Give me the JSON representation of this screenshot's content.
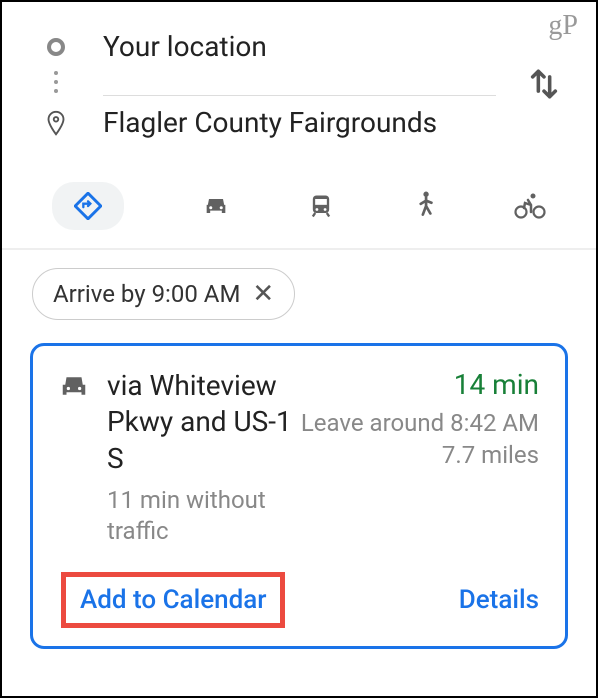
{
  "watermark": "gP",
  "locations": {
    "origin": "Your location",
    "destination": "Flagler County Fairgrounds"
  },
  "filter": {
    "label": "Arrive by 9:00 AM"
  },
  "route": {
    "via": "via Whiteview Pkwy and US-1 S",
    "without_traffic": "11 min without traffic",
    "eta": "14 min",
    "leave_around": "Leave around 8:42 AM",
    "distance": "7.7 miles",
    "add_to_calendar": "Add to Calendar",
    "details": "Details"
  }
}
